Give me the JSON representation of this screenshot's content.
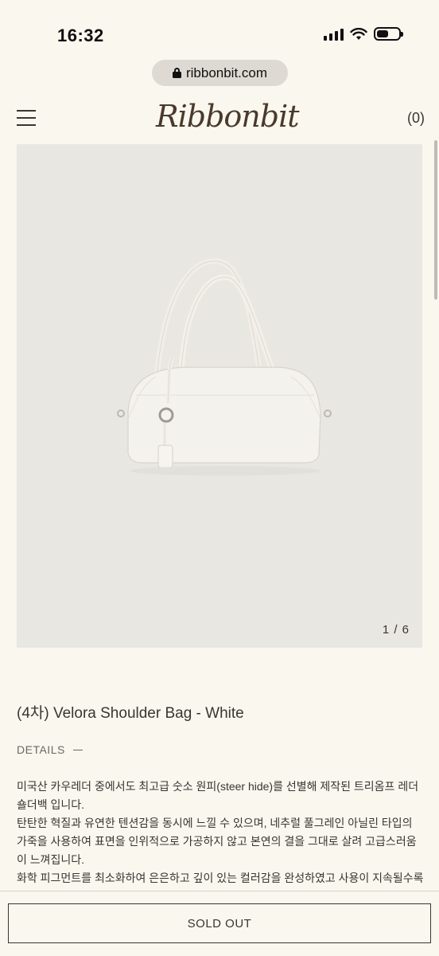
{
  "status_bar": {
    "time": "16:32"
  },
  "browser": {
    "url": "ribbonbit.com"
  },
  "header": {
    "logo": "Ribbonbit",
    "cart_count": "(0)"
  },
  "gallery": {
    "counter": "1 / 6",
    "image_subject": "white leather shoulder bag"
  },
  "product": {
    "title": "(4차) Velora Shoulder Bag - White",
    "details_label": "DETAILS",
    "description": [
      "미국산 카우레더 중에서도 최고급 숫소 원피(steer hide)를 선별해 제작된 트리옴프 레더 숄더백 입니다.",
      "탄탄한 혁질과 유연한 텐션감을 동시에 느낄 수 있으며, 네추럴 풀그레인 아닐린 타입의 가죽을 사용하여 표면을 인위적으로 가공하지 않고 본연의 결을 그대로 살려 고급스러움이 느껴집니다.",
      "화학 피그먼트를 최소화하여 은은하고 깊이 있는 컬러감을 완성하였고 사용이 지속될수록 마찰이 많은 부분은 자연스럽게 색이 바랠 수 있습니다."
    ]
  },
  "actions": {
    "sold_out_label": "SOLD OUT"
  },
  "colors": {
    "background": "#faf7ef",
    "gallery_bg": "#e9e7e2",
    "text": "#3a3530",
    "logo": "#4a3a2c"
  }
}
